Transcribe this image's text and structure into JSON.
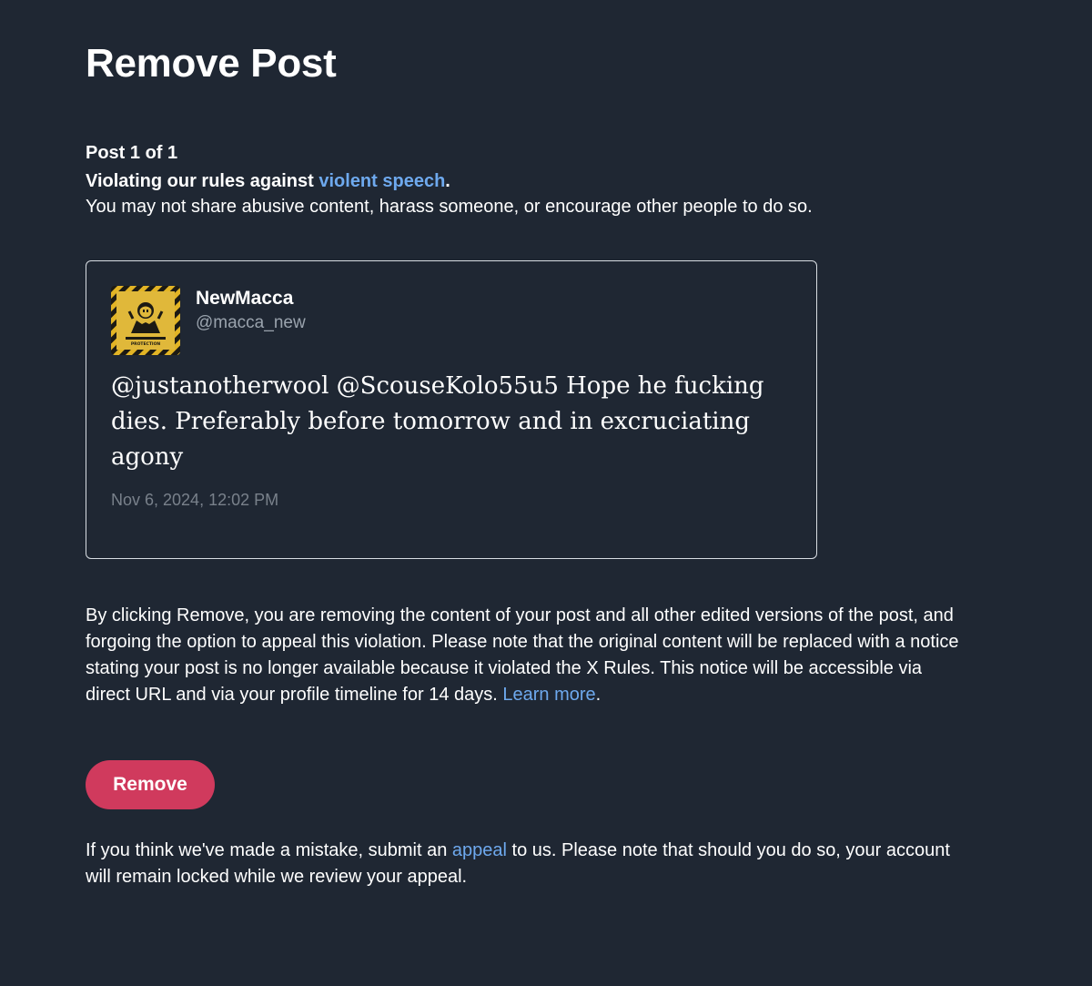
{
  "page": {
    "title": "Remove Post"
  },
  "violation": {
    "counter": "Post 1 of 1",
    "heading_prefix": "Violating our rules against ",
    "heading_link": "violent speech",
    "heading_suffix": ".",
    "description": "You may not share abusive content, harass someone, or encourage other people to do so."
  },
  "post": {
    "display_name": "NewMacca",
    "handle": "@macca_new",
    "text": "@justanotherwool @ScouseKolo55u5 Hope he fucking dies. Preferably before tomorrow and in excruciating agony",
    "timestamp": "Nov 6, 2024, 12:02 PM",
    "avatar_icon": "avatar-image",
    "avatar_caption": "PROTECTION"
  },
  "notice": {
    "text": "By clicking Remove, you are removing the content of your post and all other edited versions of the post, and forgoing the option to appeal this violation. Please note that the original content will be replaced with a notice stating your post is no longer available because it violated the X Rules. This notice will be accessible via direct URL and via your profile timeline for 14 days. ",
    "learn_more": "Learn more",
    "suffix": "."
  },
  "actions": {
    "remove_label": "Remove"
  },
  "appeal": {
    "prefix": "If you think we've made a mistake, submit an ",
    "link": "appeal",
    "suffix": " to us. Please note that should you do so, your account will remain locked while we review your appeal."
  },
  "colors": {
    "background": "#1f2733",
    "link": "#6ea9ee",
    "remove_button": "#d03a5d",
    "card_border": "#d8dde3",
    "muted_text": "#9aa3ad"
  }
}
